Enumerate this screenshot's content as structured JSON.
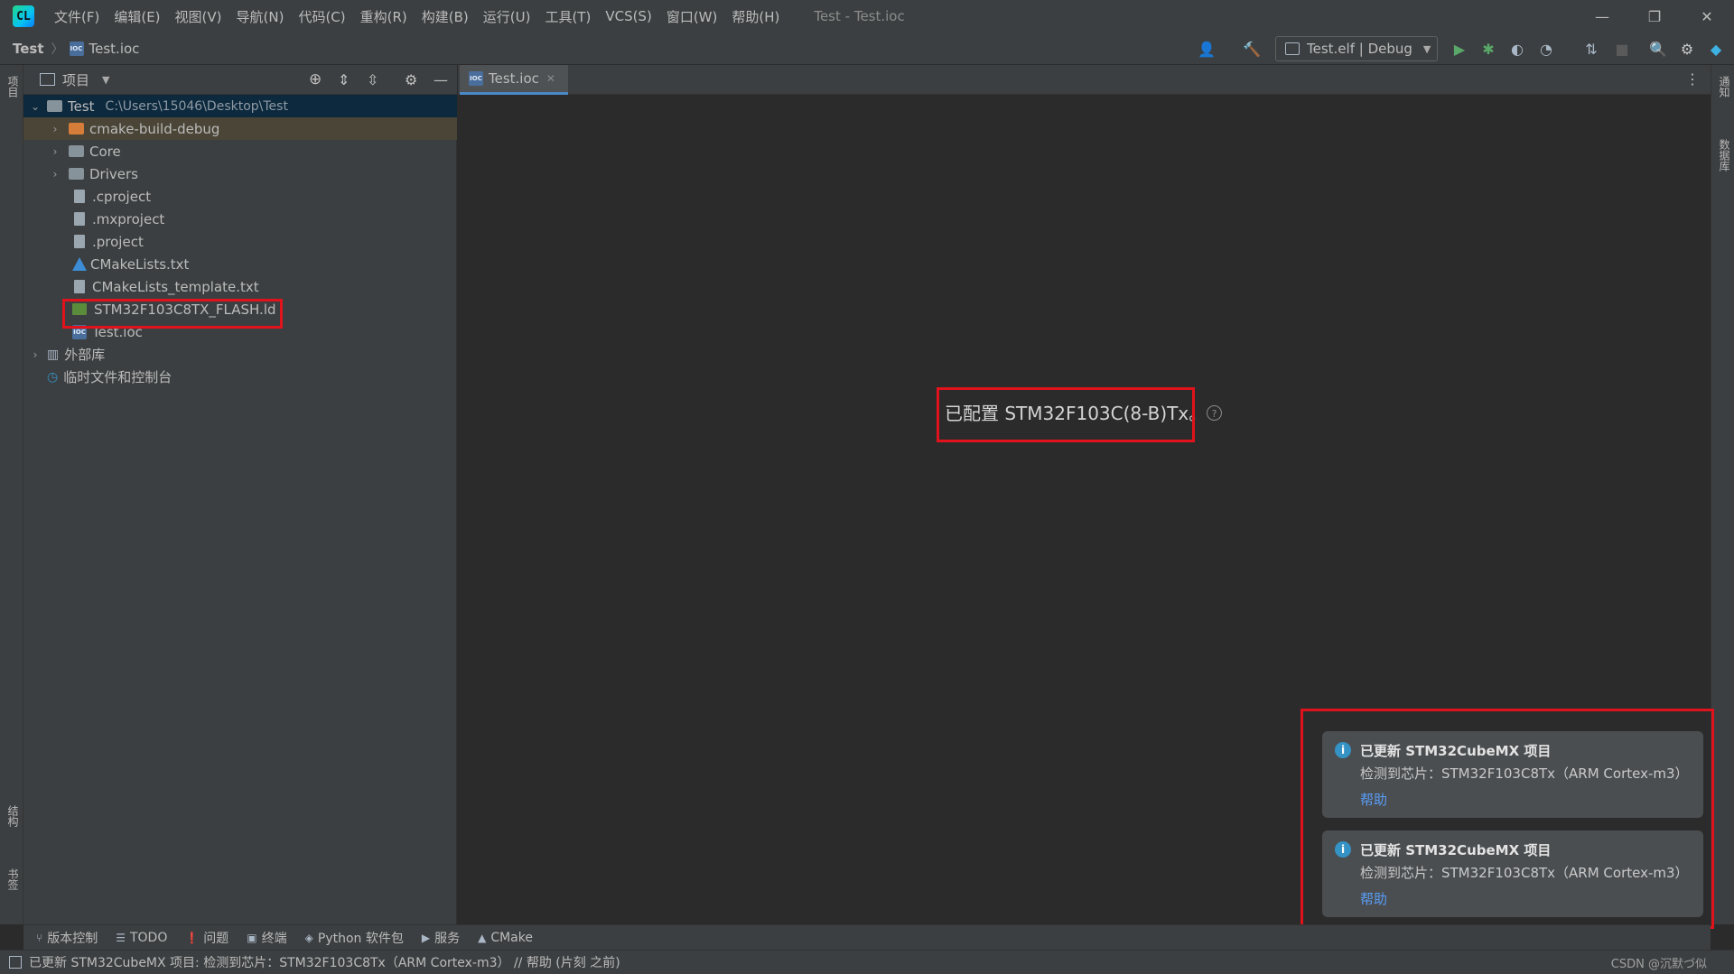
{
  "menu": [
    "文件(F)",
    "编辑(E)",
    "视图(V)",
    "导航(N)",
    "代码(C)",
    "重构(R)",
    "构建(B)",
    "运行(U)",
    "工具(T)",
    "VCS(S)",
    "窗口(W)",
    "帮助(H)"
  ],
  "window_title": "Test - Test.ioc",
  "app_logo_text": "CL",
  "breadcrumb": {
    "project": "Test",
    "file": "Test.ioc"
  },
  "run_config": "Test.elf | Debug",
  "left_strip": {
    "project": "项目",
    "structure": "结构",
    "bookmarks": "书签"
  },
  "right_strip": {
    "notifications": "通知",
    "database": "数据库"
  },
  "project_panel": {
    "title": "项目",
    "tree": {
      "root_name": "Test",
      "root_path": "C:\\Users\\15046\\Desktop\\Test",
      "items": [
        "cmake-build-debug",
        "Core",
        "Drivers",
        ".cproject",
        ".mxproject",
        ".project",
        "CMakeLists.txt",
        "CMakeLists_template.txt",
        "STM32F103C8TX_FLASH.ld",
        "Test.ioc"
      ],
      "external_libs": "外部库",
      "scratches": "临时文件和控制台"
    }
  },
  "editor": {
    "tab_label": "Test.ioc",
    "configured_text": "已配置 STM32F103C(8-B)Tx。",
    "help_glyph": "?"
  },
  "notifications": [
    {
      "title": "已更新 STM32CubeMX 项目",
      "body": "检测到芯片：STM32F103C8Tx（ARM Cortex-m3）",
      "link": "帮助"
    },
    {
      "title": "已更新 STM32CubeMX 项目",
      "body": "检测到芯片：STM32F103C8Tx（ARM Cortex-m3）",
      "link": "帮助"
    }
  ],
  "tool_tabs": [
    "版本控制",
    "TODO",
    "问题",
    "终端",
    "Python 软件包",
    "服务",
    "CMake"
  ],
  "status_text": "已更新 STM32CubeMX 项目: 检测到芯片：STM32F103C8Tx（ARM Cortex-m3） // 帮助 (片刻 之前)",
  "watermark": "CSDN @沉默づ似",
  "colors": {
    "highlight": "#e0121c",
    "accent": "#4a88c7",
    "link": "#589df6",
    "selection": "#0d293e"
  }
}
